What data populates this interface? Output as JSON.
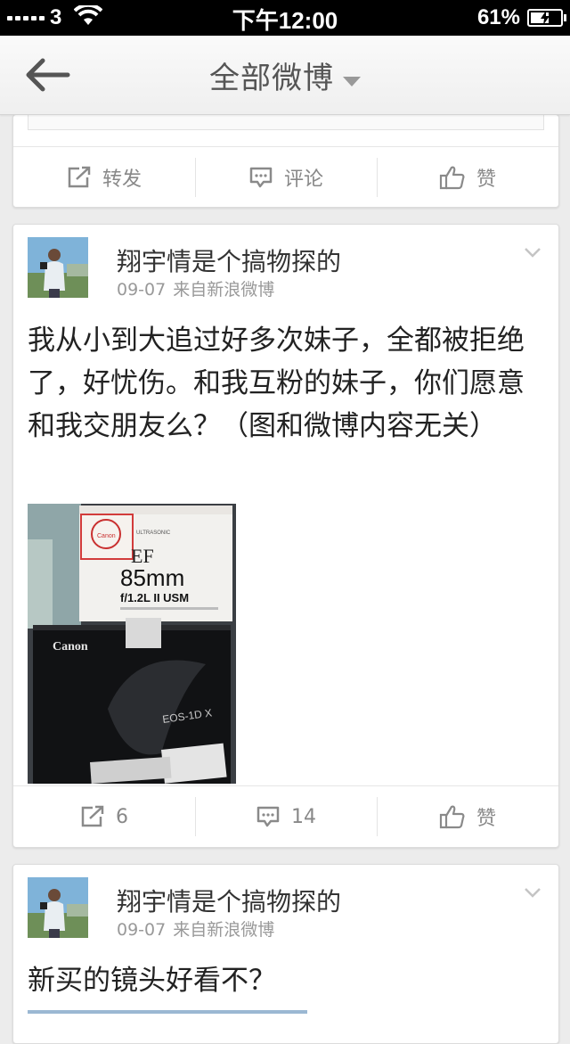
{
  "status_bar": {
    "carrier": "3",
    "time": "下午12:00",
    "battery": "61%",
    "battery_level": 0.61
  },
  "nav": {
    "title": "全部微博",
    "back_icon": "arrow-left-icon",
    "dropdown_icon": "caret-down-icon"
  },
  "top_card": {
    "repost_label": "转发",
    "comment_label": "评论",
    "like_label": "赞"
  },
  "posts": [
    {
      "username": "翔宇情是个搞物探的",
      "date": "09-07",
      "source": "来自新浪微博",
      "text": "我从小到大追过好多次妹子，全都被拒绝了，好忧伤。和我互粉的妹子，你们愿意和我交朋友么？（图和微博内容无关）",
      "photo": {
        "box_brand": "Canon",
        "lens_focal": "85mm",
        "lens_spec": "f/1.2L II USM",
        "lens_letter": "EF",
        "camera_model": "EOS-1D X"
      },
      "reposts": "6",
      "comments": "14",
      "like_label": "赞"
    },
    {
      "username": "翔宇情是个搞物探的",
      "date": "09-07",
      "source": "来自新浪微博",
      "text": "新买的镜头好看不？"
    }
  ],
  "colors": {
    "accent_text": "#333333",
    "muted": "#999999",
    "background": "#ececec"
  }
}
